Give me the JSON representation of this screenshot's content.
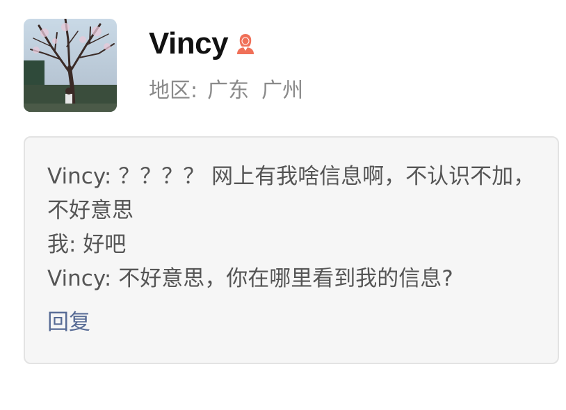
{
  "profile": {
    "name": "Vincy",
    "gender_icon": "female-person-icon",
    "gender_color": "#f07058",
    "region_label": "地区:",
    "region_province": "广东",
    "region_city": "广州"
  },
  "chat": {
    "messages": [
      "Vincy: ？？？？ 网上有我啥信息啊，不认识不加，不好意思",
      "我: 好吧",
      "Vincy: 不好意思，你在哪里看到我的信息?"
    ],
    "reply_label": "回复",
    "link_color": "#576b95"
  }
}
